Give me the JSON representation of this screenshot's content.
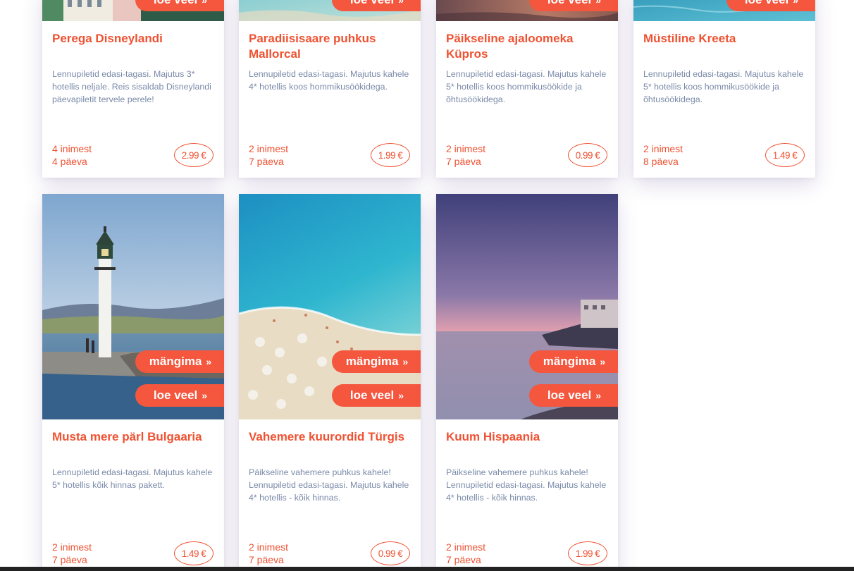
{
  "buttons": {
    "play": "mängima",
    "more": "loe veel",
    "chevron": "»"
  },
  "currency": "€",
  "colors": {
    "accent": "#f4563e",
    "title": "#ef5232",
    "description": "#7a8aa8"
  },
  "cards": [
    {
      "title": "Perega Disneylandi",
      "description": "Lennupiletid edasi-tagasi. Majutus 3* hotellis neljale. Reis sisaldab Disneylandi päevapiletit tervele perele!",
      "people": "4 inimest",
      "days": "4 päeva",
      "price": "2.99 €"
    },
    {
      "title": "Paradiisisaare puhkus Mallorcal",
      "description": "Lennupiletid edasi-tagasi. Majutus kahele 4* hotellis koos hommikusöökidega.",
      "people": "2 inimest",
      "days": "7 päeva",
      "price": "1.99 €"
    },
    {
      "title": "Päikseline ajaloomeka Küpros",
      "description": "Lennupiletid edasi-tagasi. Majutus kahele 5* hotellis koos hommikusöökide ja õhtusöökidega.",
      "people": "2 inimest",
      "days": "7 päeva",
      "price": "0.99 €"
    },
    {
      "title": "Müstiline Kreeta",
      "description": "Lennupiletid edasi-tagasi. Majutus kahele 5* hotellis koos hommikusöökide ja õhtusöökidega.",
      "people": "2 inimest",
      "days": "8 päeva",
      "price": "1.49 €"
    },
    {
      "title": "Musta mere pärl Bulgaaria",
      "description": "Lennupiletid edasi-tagasi. Majutus kahele 5* hotellis kõik hinnas pakett.",
      "people": "2 inimest",
      "days": "7 päeva",
      "price": "1.49 €"
    },
    {
      "title": "Vahemere kuurordid Türgis",
      "description": "Päikseline vahemere puhkus kahele! Lennupiletid edasi-tagasi. Majutus kahele 4* hotellis - kõik hinnas.",
      "people": "2 inimest",
      "days": "7 päeva",
      "price": "0.99 €"
    },
    {
      "title": "Kuum Hispaania",
      "description": "Päikseline vahemere puhkus kahele! Lennupiletid edasi-tagasi. Majutus kahele 4* hotellis - kõik hinnas.",
      "people": "2 inimest",
      "days": "7 päeva",
      "price": "1.99 €"
    }
  ]
}
